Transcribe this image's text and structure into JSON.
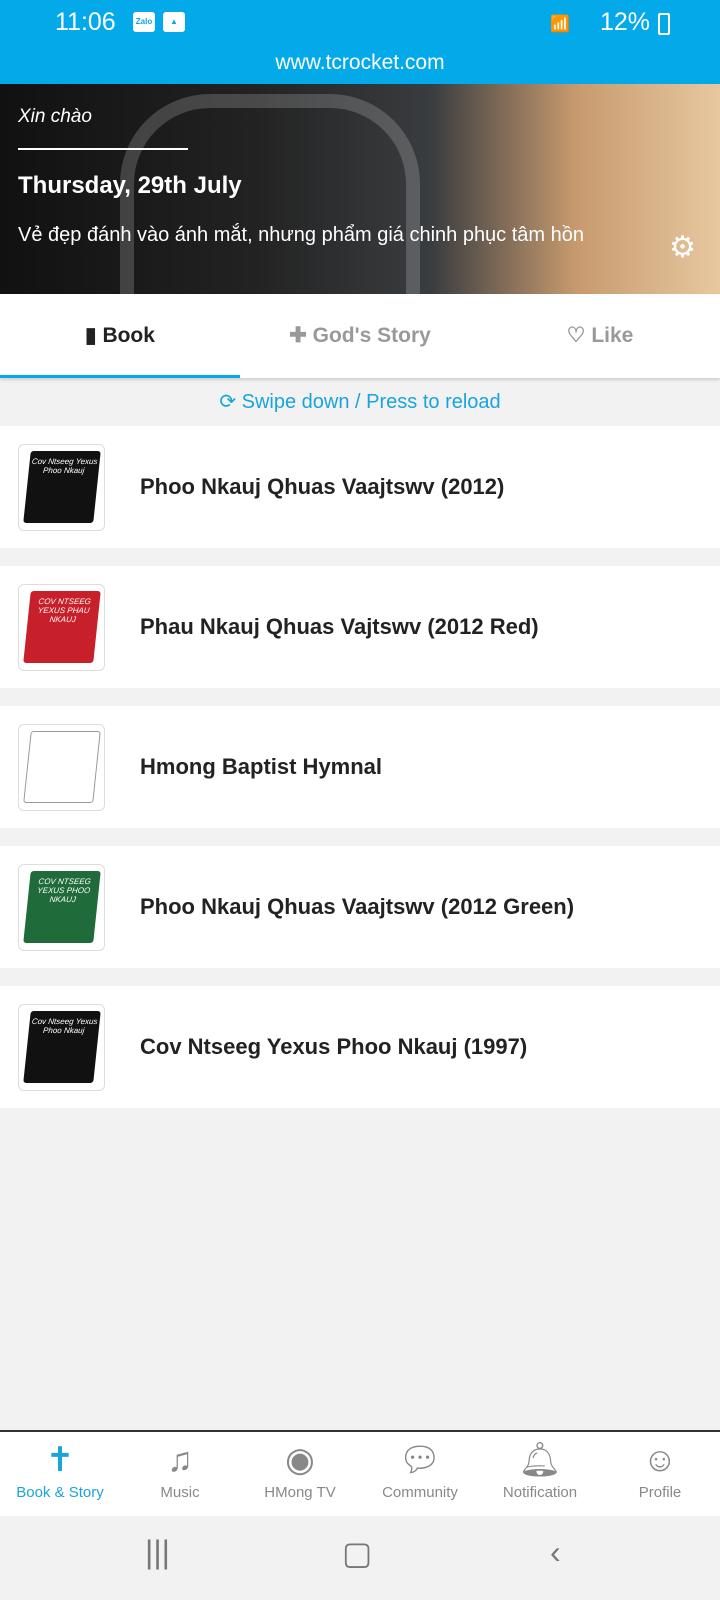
{
  "status": {
    "time": "11:06",
    "notif_icons": [
      "zalo-icon",
      "gallery-icon"
    ],
    "battery": "12%"
  },
  "url": "www.tcrocket.com",
  "hero": {
    "greeting": "Xin chào",
    "date": "Thursday, 29th July",
    "quote": "Vẻ đẹp đánh vào ánh mắt, nhưng phẩm giá chinh phục tâm hồn"
  },
  "tabs": [
    {
      "label": "Book",
      "icon": "book-icon",
      "active": true
    },
    {
      "label": "God's Story",
      "icon": "bible-plus-icon"
    },
    {
      "label": "Like",
      "icon": "heart-icon"
    }
  ],
  "reload": "Swipe down / Press to reload",
  "books": [
    {
      "title": "Phoo Nkauj Qhuas Vaajtswv (2012)",
      "cover": "#111111",
      "cover_text": "Cov Ntseeg Yexus Phoo Nkauj"
    },
    {
      "title": "Phau Nkauj Qhuas Vajtswv (2012 Red)",
      "cover": "#c8202a",
      "cover_text": "COV NTSEEG YEXUS PHAU NKAUJ"
    },
    {
      "title": "Hmong Baptist Hymnal",
      "cover": "#ffffff",
      "cover_text": ""
    },
    {
      "title": "Phoo Nkauj Qhuas Vaajtswv (2012 Green)",
      "cover": "#1f6b3a",
      "cover_text": "COV NTSEEG YEXUS PHOO NKAUJ"
    },
    {
      "title": "Cov Ntseeg Yexus Phoo Nkauj (1997)",
      "cover": "#111111",
      "cover_text": "Cov Ntseeg Yexus Phoo Nkauj"
    }
  ],
  "bottom_nav": [
    {
      "label": "Book & Story",
      "icon": "bible-icon",
      "active": true
    },
    {
      "label": "Music",
      "icon": "music-icon"
    },
    {
      "label": "HMong TV",
      "icon": "podcast-icon"
    },
    {
      "label": "Community",
      "icon": "chat-icon"
    },
    {
      "label": "Notification",
      "icon": "bell-icon"
    },
    {
      "label": "Profile",
      "icon": "user-icon"
    }
  ],
  "colors": {
    "accent": "#03a9e8",
    "link": "#1ba3dc"
  }
}
